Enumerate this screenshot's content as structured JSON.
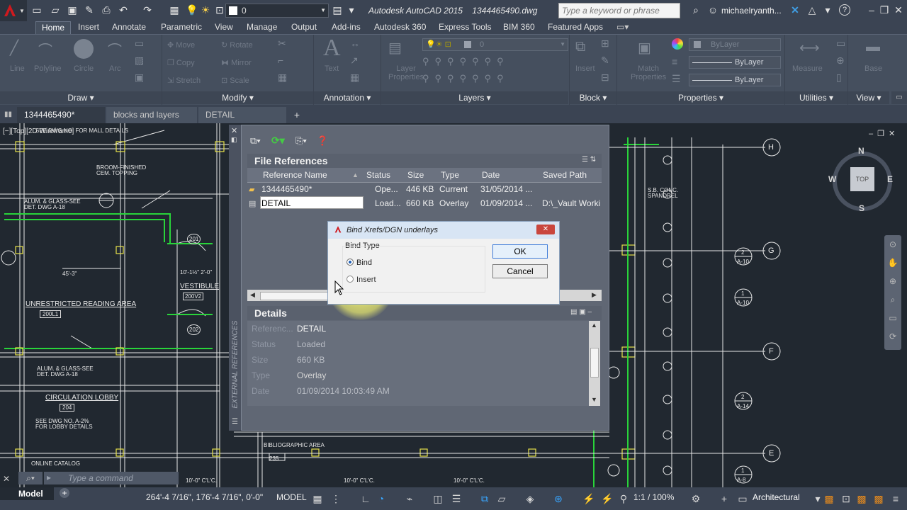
{
  "titlebar": {
    "title": "Autodesk AutoCAD 2015    1344465490.dwg",
    "layer_value": "0",
    "search_placeholder": "Type a keyword or phrase",
    "user": "michaelryanth..."
  },
  "ribbon_tabs": [
    "Home",
    "Insert",
    "Annotate",
    "Parametric",
    "View",
    "Manage",
    "Output",
    "Add-ins",
    "Autodesk 360",
    "Express Tools",
    "BIM 360",
    "Featured Apps"
  ],
  "ribbon": {
    "draw": {
      "title": "Draw",
      "line": "Line",
      "polyline": "Polyline",
      "circle": "Circle",
      "arc": "Arc"
    },
    "modify": {
      "title": "Modify",
      "move": "Move",
      "rotate": "Rotate",
      "copy": "Copy",
      "mirror": "Mirror",
      "stretch": "Stretch",
      "scale": "Scale"
    },
    "annotation": {
      "title": "Annotation",
      "text": "Text"
    },
    "layers": {
      "title": "Layers",
      "layer_properties_1": "Layer",
      "layer_properties_2": "Properties",
      "layer_value": "0"
    },
    "block": {
      "title": "Block",
      "insert": "Insert"
    },
    "properties": {
      "title": "Properties",
      "match_1": "Match",
      "match_2": "Properties",
      "bylayer_color": "ByLayer",
      "bylayer_line": "ByLayer",
      "bylayer_weight": "ByLayer"
    },
    "utilities": {
      "title": "Utilities",
      "measure": "Measure"
    },
    "view": {
      "title": "View",
      "base": "Base"
    }
  },
  "doc_tabs": [
    "1344465490*",
    "blocks and layers",
    "DETAIL"
  ],
  "viewport_label": "[−][Top][2D Wireframe]",
  "viewcube": {
    "n": "N",
    "s": "S",
    "e": "E",
    "w": "W",
    "top": "TOP"
  },
  "xref": {
    "side_title": "EXTERNAL REFERENCES",
    "file_refs_title": "File References",
    "columns": [
      "Reference Name",
      "Status",
      "Size",
      "Type",
      "Date",
      "Saved Path"
    ],
    "rows": [
      {
        "name": "1344465490*",
        "status": "Ope...",
        "size": "446 KB",
        "type": "Current",
        "date": "31/05/2014 ...",
        "path": ""
      },
      {
        "name": "DETAIL",
        "status": "Load...",
        "size": "660 KB",
        "type": "Overlay",
        "date": "01/09/2014 ...",
        "path": "D:\\_Vault Worki"
      }
    ],
    "details_title": "Details",
    "details": [
      {
        "label": "Referenc...",
        "value": "DETAIL"
      },
      {
        "label": "Status",
        "value": "Loaded"
      },
      {
        "label": "Size",
        "value": "660 KB"
      },
      {
        "label": "Type",
        "value": "Overlay"
      },
      {
        "label": "Date",
        "value": "01/09/2014 10:03:49 AM"
      }
    ]
  },
  "dialog": {
    "title": "Bind Xrefs/DGN underlays",
    "group_label": "Bind Type",
    "opt_bind": "Bind",
    "opt_insert": "Insert",
    "ok": "OK",
    "cancel": "Cancel"
  },
  "cad_labels": {
    "see_dwg_mall": "SEE DWG NO.  FOR MALL DETAILS",
    "broom": "BROOM-FINISHED",
    "cem": "CEM. TOPPING",
    "alum1": "ALUM. & GLASS-SEE",
    "alum1b": "DET. DWG A-18",
    "dim45": "45'-3\"",
    "unrestricted": "UNRESTRICTED READING AREA",
    "tag200": "200L1",
    "tag201": "201",
    "tag202": "202",
    "vestibule": "VESTIBULE",
    "tag200v": "200V2",
    "dim10": "10'-1½\"   2'-0\"",
    "alum2": "ALUM. & GLASS-SEE",
    "alum2b": "DET. DWG A-18",
    "circulation": "CIRCULATION LOBBY",
    "tag204": "204",
    "see_dwg_lobby": "SEE DWG NO. A-2%",
    "lobby_details": "FOR LOBBY DETAILS",
    "online": "ONLINE CATALOG",
    "bibliographic": "BIBLIOGRAPHIC AREA",
    "tag235": "235",
    "cl1": "10'-0\" C'L'C.",
    "cl2": "10'-0\" C'L'C.",
    "cl3": "10'-0\" C'L'C.",
    "sb_conc": "S.B. CONC.",
    "spandrel": "SPANDREL",
    "grid_h": "H",
    "grid_g": "G",
    "grid_f": "F",
    "grid_e": "E",
    "bub_2_10": [
      "2",
      "A-10"
    ],
    "bub_1_10": [
      "1",
      "A-10"
    ],
    "bub_2_14": [
      "2",
      "A-14"
    ],
    "bub_1_8": [
      "1",
      "A-8"
    ]
  },
  "command": {
    "placeholder": "Type a command"
  },
  "statusbar": {
    "model_tab": "Model",
    "coords": "264'-4 7/16\", 176'-4 7/16\", 0'-0\"",
    "model": "MODEL",
    "scale": "1:1 / 100%",
    "workspace": "Architectural"
  }
}
